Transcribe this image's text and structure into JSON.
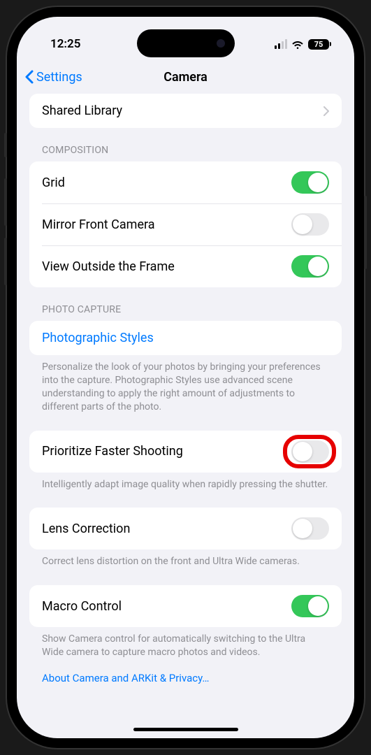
{
  "status": {
    "time": "12:25",
    "battery": "75"
  },
  "nav": {
    "back": "Settings",
    "title": "Camera"
  },
  "shared_library": {
    "label": "Shared Library"
  },
  "composition": {
    "header": "COMPOSITION",
    "grid": {
      "label": "Grid",
      "on": true
    },
    "mirror": {
      "label": "Mirror Front Camera",
      "on": false
    },
    "outside_frame": {
      "label": "View Outside the Frame",
      "on": true
    }
  },
  "photo_capture": {
    "header": "PHOTO CAPTURE",
    "styles": {
      "label": "Photographic Styles"
    },
    "styles_footer": "Personalize the look of your photos by bringing your preferences into the capture. Photographic Styles use advanced scene understanding to apply the right amount of adjustments to different parts of the photo.",
    "prioritize": {
      "label": "Prioritize Faster Shooting",
      "on": false
    },
    "prioritize_footer": "Intelligently adapt image quality when rapidly pressing the shutter.",
    "lens_correction": {
      "label": "Lens Correction",
      "on": false
    },
    "lens_footer": "Correct lens distortion on the front and Ultra Wide cameras.",
    "macro": {
      "label": "Macro Control",
      "on": true
    },
    "macro_footer": "Show Camera control for automatically switching to the Ultra Wide camera to capture macro photos and videos."
  },
  "privacy_link": "About Camera and ARKit & Privacy…"
}
